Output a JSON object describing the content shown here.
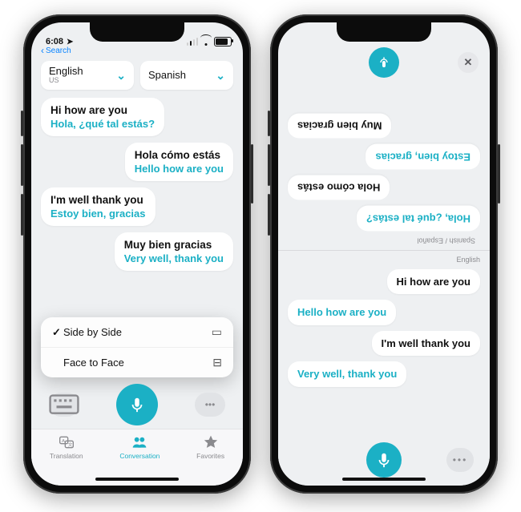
{
  "status": {
    "time": "6:08",
    "back_label": "Search"
  },
  "accent": "#1bb0c5",
  "phone1": {
    "lang_from": {
      "name": "English",
      "sub": "US"
    },
    "lang_to": {
      "name": "Spanish",
      "sub": ""
    },
    "messages": [
      {
        "side": "left",
        "src": "Hi how are you",
        "tr": "Hola, ¿qué tal estás?"
      },
      {
        "side": "right",
        "src": "Hola cómo estás",
        "tr": "Hello how are you"
      },
      {
        "side": "left",
        "src": "I'm well thank you",
        "tr": "Estoy bien, gracias"
      },
      {
        "side": "right",
        "src": "Muy bien gracias",
        "tr": "Very well, thank you"
      }
    ],
    "menu": {
      "opt1": "Side by Side",
      "opt2": "Face to Face",
      "opt1_selected": true
    },
    "tabs": {
      "t1": "Translation",
      "t2": "Conversation",
      "t3": "Favorites",
      "active": "t2"
    }
  },
  "phone2": {
    "top_lang_label": "Spanish / Español",
    "bottom_lang_label": "English",
    "top_bubbles": [
      {
        "kind": "bold",
        "text": "Muy bien gracias"
      },
      {
        "kind": "teal",
        "text": "Estoy bien, gracias"
      },
      {
        "kind": "bold",
        "text": "Hola cómo estás"
      },
      {
        "kind": "teal",
        "text": "Hola, ¿qué tal estás?"
      }
    ],
    "bottom_bubbles": [
      {
        "kind": "bold",
        "text": "Hi how are you"
      },
      {
        "kind": "teal",
        "text": "Hello how are you"
      },
      {
        "kind": "bold",
        "text": "I'm well thank you"
      },
      {
        "kind": "teal",
        "text": "Very well, thank you"
      }
    ]
  }
}
